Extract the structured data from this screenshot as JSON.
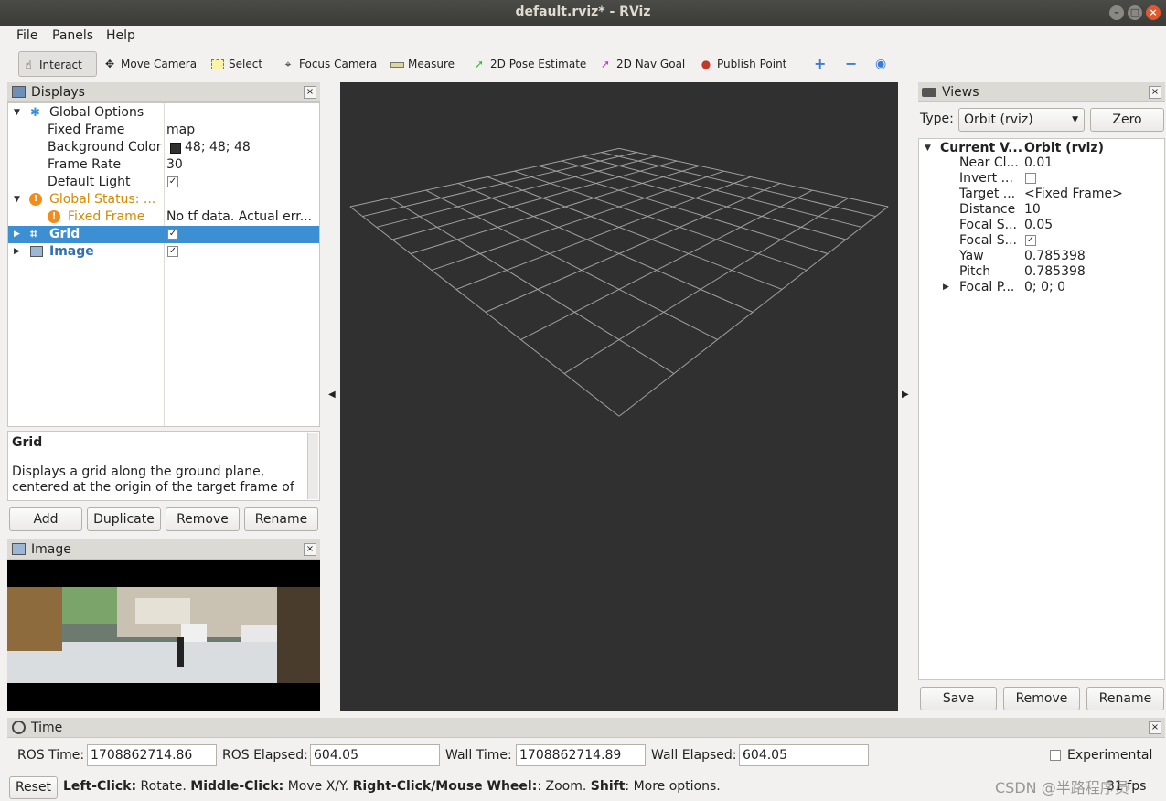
{
  "window": {
    "title": "default.rviz* - RViz"
  },
  "menu": {
    "file": "File",
    "panels": "Panels",
    "help": "Help"
  },
  "toolbar": {
    "interact": "Interact",
    "move_camera": "Move Camera",
    "select": "Select",
    "focus_camera": "Focus Camera",
    "measure": "Measure",
    "pose_estimate": "2D Pose Estimate",
    "nav_goal": "2D Nav Goal",
    "publish_point": "Publish Point"
  },
  "displays": {
    "title": "Displays",
    "global_options": "Global Options",
    "fixed_frame_label": "Fixed Frame",
    "fixed_frame_value": "map",
    "bg_color_label": "Background Color",
    "bg_color_value": "48; 48; 48",
    "frame_rate_label": "Frame Rate",
    "frame_rate_value": "30",
    "default_light_label": "Default Light",
    "global_status": "Global Status: ...",
    "status_fixed_frame": "Fixed Frame",
    "status_fixed_frame_value": "No tf data.  Actual err...",
    "grid": "Grid",
    "image": "Image",
    "desc_title": "Grid",
    "desc_text": "Displays a grid along the ground plane, centered at the origin of the target frame of",
    "buttons": {
      "add": "Add",
      "duplicate": "Duplicate",
      "remove": "Remove",
      "rename": "Rename"
    }
  },
  "image_panel": {
    "title": "Image"
  },
  "views": {
    "title": "Views",
    "type_label": "Type:",
    "type_value": "Orbit (rviz)",
    "zero": "Zero",
    "current_view": "Current V...",
    "current_view_value": "Orbit (rviz)",
    "props": [
      {
        "name": "Near Cl...",
        "value": "0.01"
      },
      {
        "name": "Invert ...",
        "value": ""
      },
      {
        "name": "Target ...",
        "value": "<Fixed Frame>"
      },
      {
        "name": "Distance",
        "value": "10"
      },
      {
        "name": "Focal S...",
        "value": "0.05"
      },
      {
        "name": "Focal S...",
        "value": ""
      },
      {
        "name": "Yaw",
        "value": "0.785398"
      },
      {
        "name": "Pitch",
        "value": "0.785398"
      },
      {
        "name": "Focal P...",
        "value": "0; 0; 0"
      }
    ],
    "buttons": {
      "save": "Save",
      "remove": "Remove",
      "rename": "Rename"
    }
  },
  "time": {
    "title": "Time",
    "ros_time_label": "ROS Time:",
    "ros_time": "1708862714.86",
    "ros_elapsed_label": "ROS Elapsed:",
    "ros_elapsed": "604.05",
    "wall_time_label": "Wall Time:",
    "wall_time": "1708862714.89",
    "wall_elapsed_label": "Wall Elapsed:",
    "wall_elapsed": "604.05",
    "experimental": "Experimental"
  },
  "status": {
    "reset": "Reset",
    "left_click": "Left-Click:",
    "left_click_desc": " Rotate.",
    "middle_click": "Middle-Click:",
    "middle_click_desc": " Move X/Y.",
    "right_click": "Right-Click/Mouse Wheel:",
    "right_click_desc": ": Zoom.",
    "shift": "Shift",
    "shift_desc": ": More options.",
    "fps": "31 fps",
    "watermark": "CSDN @半路程序员"
  },
  "colors": {
    "viewport_bg": "#303030",
    "selection": "#3d8fd3",
    "warning": "#d68a00"
  }
}
